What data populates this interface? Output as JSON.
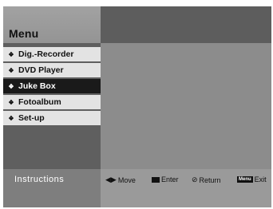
{
  "header": {
    "title": "Menu"
  },
  "sidebar": {
    "items": [
      {
        "label": "Dig.-Recorder",
        "selected": false
      },
      {
        "label": "DVD Player",
        "selected": false
      },
      {
        "label": "Juke Box",
        "selected": true
      },
      {
        "label": "Fotoalbum",
        "selected": false
      },
      {
        "label": "Set-up",
        "selected": false
      }
    ],
    "bullet_icon": "diamond-bullet-icon"
  },
  "footer": {
    "title": "Instructions",
    "move": {
      "icon": "left-right-arrows-icon",
      "label": "Move"
    },
    "enter": {
      "icon": "enter-key-icon",
      "label": "Enter"
    },
    "return": {
      "icon": "return-icon",
      "label": "Return"
    },
    "exit": {
      "icon": "menu-key-icon",
      "key_label": "Menu",
      "label": "Exit"
    }
  },
  "colors": {
    "selected_bg": "#1a1a1a",
    "item_bg": "#e3e3e3"
  }
}
